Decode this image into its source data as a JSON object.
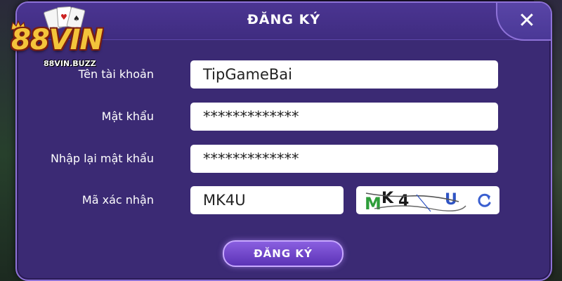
{
  "brand": {
    "logo_text": "88VIN",
    "url_text": "88VIN.BUZZ"
  },
  "dialog": {
    "title": "ĐĂNG KÝ",
    "close_glyph": "✕"
  },
  "form": {
    "username": {
      "label": "Tên tài khoản",
      "value": "TipGameBai"
    },
    "password": {
      "label": "Mật khẩu",
      "value": "*************"
    },
    "confirm_password": {
      "label": "Nhập lại mật khẩu",
      "value": "*************"
    },
    "captcha": {
      "label": "Mã xác nhận",
      "value": "MK4U",
      "image_text": "MK4U"
    }
  },
  "submit_label": "ĐĂNG KÝ",
  "icons": {
    "close": "close-icon",
    "refresh": "refresh-icon"
  },
  "colors": {
    "panel": "#3b2a74",
    "panel_border": "#8e72d8",
    "button_top": "#8a5fe0",
    "button_bottom": "#5b33b6",
    "logo_gold": "#f4c43a",
    "captcha_green": "#2e9e3a",
    "captcha_blue": "#2f54c4"
  }
}
